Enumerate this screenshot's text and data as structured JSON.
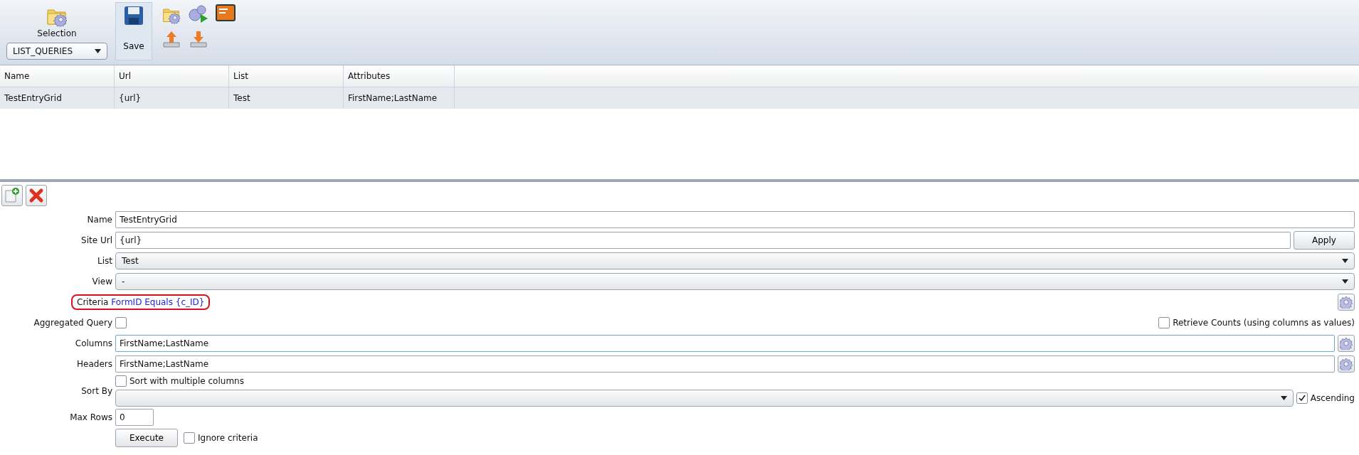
{
  "toolbar": {
    "selection_label": "Selection",
    "selection_value": "LIST_QUERIES",
    "save_label": "Save"
  },
  "table": {
    "columns": [
      "Name",
      "Url",
      "List",
      "Attributes"
    ],
    "rows": [
      {
        "cells": [
          "TestEntryGrid",
          "{url}",
          "Test",
          "FirstName;LastName"
        ],
        "selected": true
      }
    ]
  },
  "form": [
    {
      "kind": "text",
      "label": "Name",
      "value": "TestEntryGrid"
    },
    {
      "kind": "text_button",
      "label": "Site Url",
      "value": "{url}",
      "button": "Apply"
    },
    {
      "kind": "dropdown",
      "label": "List",
      "value": "Test"
    },
    {
      "kind": "dropdown",
      "label": "View",
      "value": "-"
    },
    {
      "kind": "criteria",
      "label": "Criteria",
      "value": "FormID Equals {c_ID}",
      "highlighted": true
    },
    {
      "kind": "checkbox",
      "label": "Aggregated Query",
      "checked": false,
      "extra": {
        "label": "Retrieve Counts (using columns as values)",
        "checked": false
      }
    },
    {
      "kind": "text_gear",
      "label": "Columns",
      "value": "FirstName;LastName",
      "focused": true
    },
    {
      "kind": "text_gear",
      "label": "Headers",
      "value": "FirstName;LastName",
      "focused": false
    },
    {
      "kind": "sort",
      "label": "Sort By",
      "multi": {
        "label": "Sort with multiple columns",
        "checked": false
      },
      "ascending": {
        "label": "Ascending",
        "checked": true
      }
    },
    {
      "kind": "short_text",
      "label": "Max Rows",
      "value": "0"
    },
    {
      "kind": "execute",
      "button": "Execute",
      "ignore": {
        "label": "Ignore criteria",
        "checked": false
      }
    }
  ]
}
